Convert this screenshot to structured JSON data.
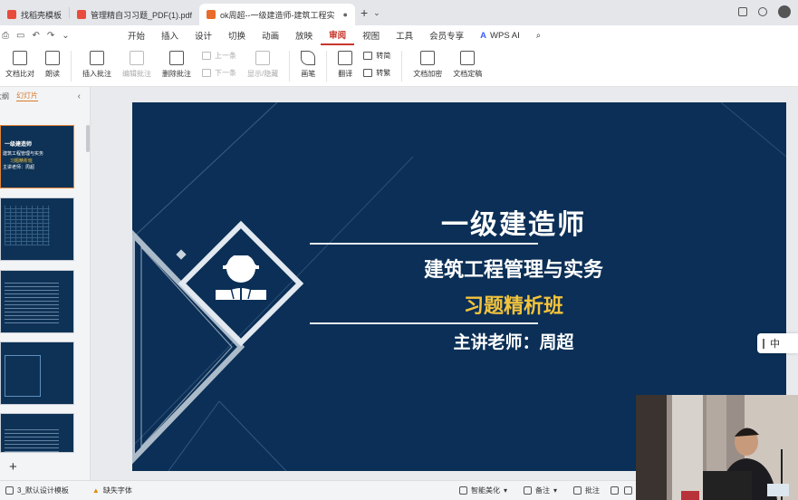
{
  "tabs": [
    {
      "label": "找稻壳模板",
      "color": "#e84b3c",
      "active": false
    },
    {
      "label": "管理精自习习题_PDF(1).pdf",
      "color": "#e84b3c",
      "active": false
    },
    {
      "label": "ok周超--一级建造师-建筑工程实",
      "color": "#e86b2c",
      "active": true
    }
  ],
  "menu": [
    "开始",
    "插入",
    "设计",
    "切换",
    "动画",
    "放映",
    "审阅",
    "视图",
    "工具",
    "会员专享"
  ],
  "menu_active": "审阅",
  "wps_ai": "WPS AI",
  "ribbon": {
    "compare": "文档比对",
    "read": "朗读",
    "insert_comment": "插入批注",
    "edit_comment": "编辑批注",
    "delete_comment": "删除批注",
    "prev": "上一条",
    "next": "下一条",
    "show_hide": "显示/隐藏",
    "pen": "画笔",
    "translate": "翻译",
    "to_simplified": "转简",
    "to_traditional": "转繁",
    "encrypt": "文档加密",
    "finalize": "文档定稿"
  },
  "left_panel": {
    "tab_outline": "大纲",
    "tab_slides": "幻灯片"
  },
  "thumb1": {
    "line1": "一级建造师",
    "line2": "建筑工程管理与实务",
    "line3": "习题精析班",
    "line4": "主讲老师：周超"
  },
  "slide": {
    "title": "一级建造师",
    "subtitle": "建筑工程管理与实务",
    "class_name": "习题精析班",
    "teacher": "主讲老师：周超",
    "colors": {
      "background": "#0b2f56",
      "accent": "#f3c33c"
    }
  },
  "ime": "中",
  "status": {
    "template": "3_默认设计模板",
    "missing_font": "缺失字体",
    "beautify": "智能美化",
    "notes": "备注",
    "comments": "批注"
  }
}
